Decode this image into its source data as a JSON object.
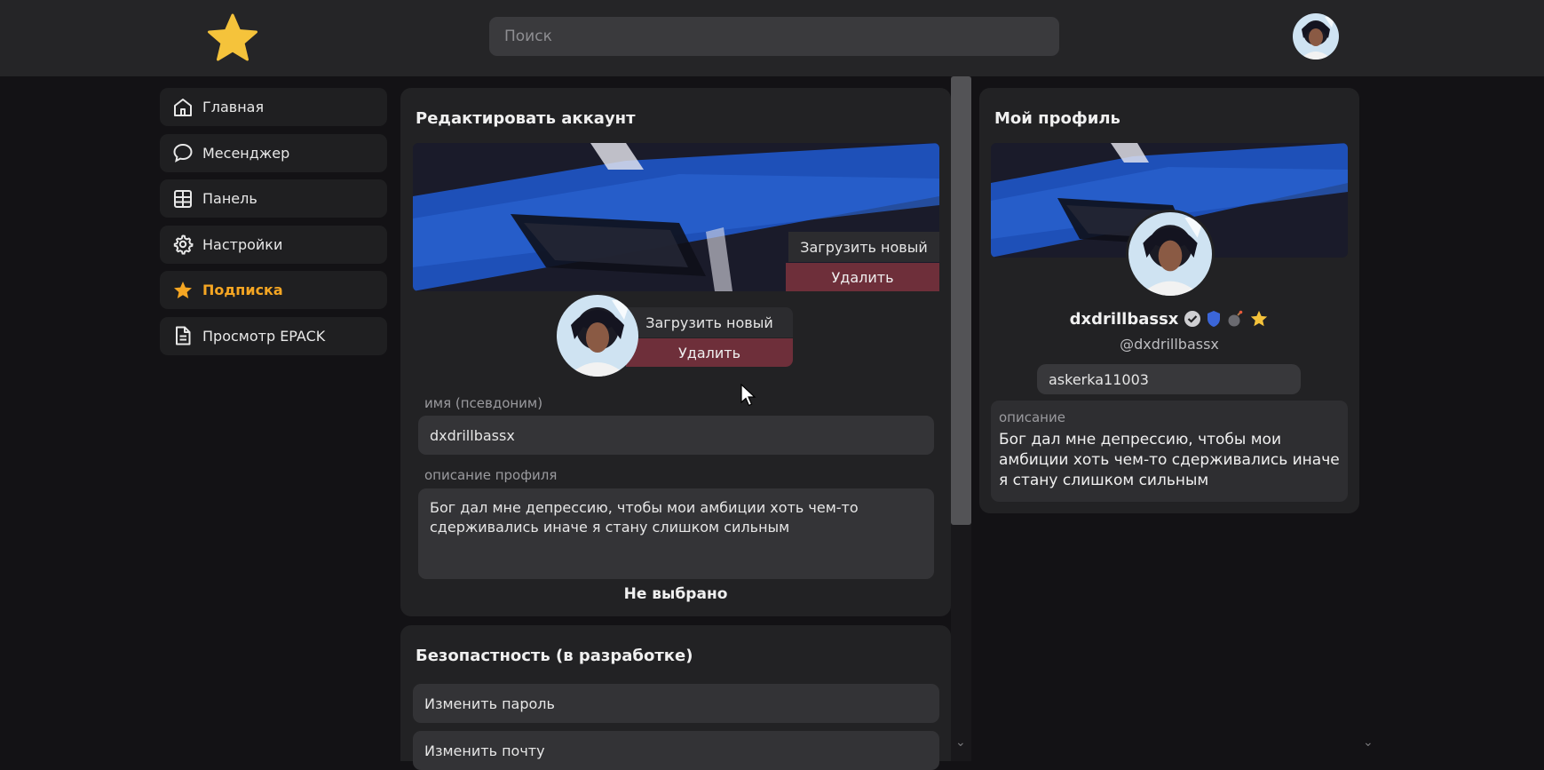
{
  "header": {
    "search_placeholder": "Поиск"
  },
  "sidebar": {
    "items": [
      {
        "label": "Главная",
        "icon": "home-icon"
      },
      {
        "label": "Месенджер",
        "icon": "chat-icon"
      },
      {
        "label": "Панель",
        "icon": "dashboard-icon"
      },
      {
        "label": "Настройки",
        "icon": "gear-icon"
      },
      {
        "label": "Подписка",
        "icon": "star-icon",
        "active": true
      },
      {
        "label": "Просмотр EPACK",
        "icon": "document-icon"
      }
    ]
  },
  "edit_account": {
    "title": "Редактировать аккаунт",
    "banner_upload_label": "Загрузить новый",
    "banner_delete_label": "Удалить",
    "avatar_upload_label": "Загрузить новый",
    "avatar_delete_label": "Удалить",
    "name_label": "имя (псевдоним)",
    "name_value": "dxdrillbassx",
    "description_label": "описание профиля",
    "description_value": "Бог дал мне депрессию, чтобы мои амбиции хоть чем-то сдерживались иначе я стану слишком сильным",
    "not_selected": "Не выбрано"
  },
  "security": {
    "title": "Безопастность (в разработке)",
    "change_password": "Изменить пароль",
    "change_email": "Изменить почту"
  },
  "my_profile": {
    "title": "Мой профиль",
    "username": "dxdrillbassx",
    "handle": "@dxdrillbassx",
    "chip": "askerka11003",
    "description_label": "описание",
    "description_text": "Бог дал мне депрессию, чтобы мои амбиции хоть чем-то сдерживались иначе я стану слишком сильным",
    "badges": [
      "verified-badge-icon",
      "shield-badge-icon",
      "bomb-badge-icon",
      "star-badge-icon"
    ]
  },
  "colors": {
    "accent": "#f5a623",
    "delete": "#6e2f3a",
    "banner_blue": "#1e50b8"
  }
}
